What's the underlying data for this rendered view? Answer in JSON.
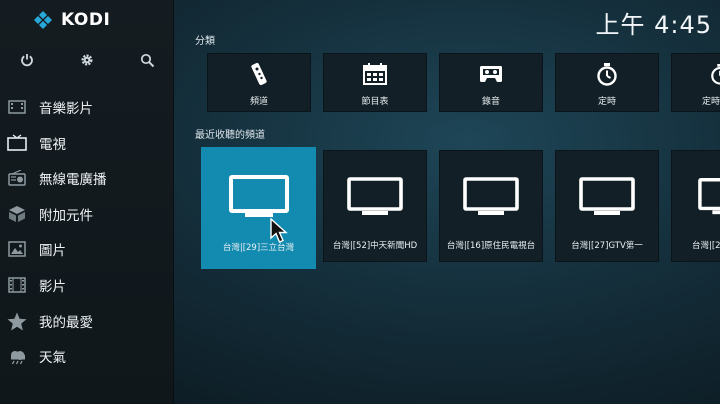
{
  "app": {
    "name": "KODI"
  },
  "clock": {
    "time": "上午 4:45"
  },
  "toolbar": {
    "icons": [
      "power-icon",
      "settings-icon",
      "search-icon"
    ]
  },
  "sidebar": {
    "items": [
      {
        "label": "音樂影片",
        "icon": "music-video-icon"
      },
      {
        "label": "電視",
        "icon": "tv-icon"
      },
      {
        "label": "無線電廣播",
        "icon": "radio-icon"
      },
      {
        "label": "附加元件",
        "icon": "addon-box-icon"
      },
      {
        "label": "圖片",
        "icon": "picture-icon"
      },
      {
        "label": "影片",
        "icon": "film-icon"
      },
      {
        "label": "我的最愛",
        "icon": "star-icon"
      },
      {
        "label": "天氣",
        "icon": "weather-icon"
      }
    ]
  },
  "categories": {
    "title": "分類",
    "items": [
      {
        "label": "頻道",
        "icon": "remote-icon"
      },
      {
        "label": "節目表",
        "icon": "guide-calendar-icon"
      },
      {
        "label": "錄音",
        "icon": "cassette-icon"
      },
      {
        "label": "定時",
        "icon": "timer-icon"
      },
      {
        "label": "定時",
        "icon": "timer-icon"
      }
    ]
  },
  "recent_channels": {
    "title": "最近收聽的頻道",
    "items": [
      {
        "label": "台灣|[29]三立台灣",
        "focused": true
      },
      {
        "label": "台灣|[52]中天新聞HD",
        "focused": false
      },
      {
        "label": "台灣|[16]原住民電視台",
        "focused": false
      },
      {
        "label": "台灣|[27]GTV第一",
        "focused": false
      },
      {
        "label": "台灣|[29",
        "focused": false
      }
    ]
  },
  "colors": {
    "focus": "#138bb0",
    "logo": "#2aa7d9"
  }
}
